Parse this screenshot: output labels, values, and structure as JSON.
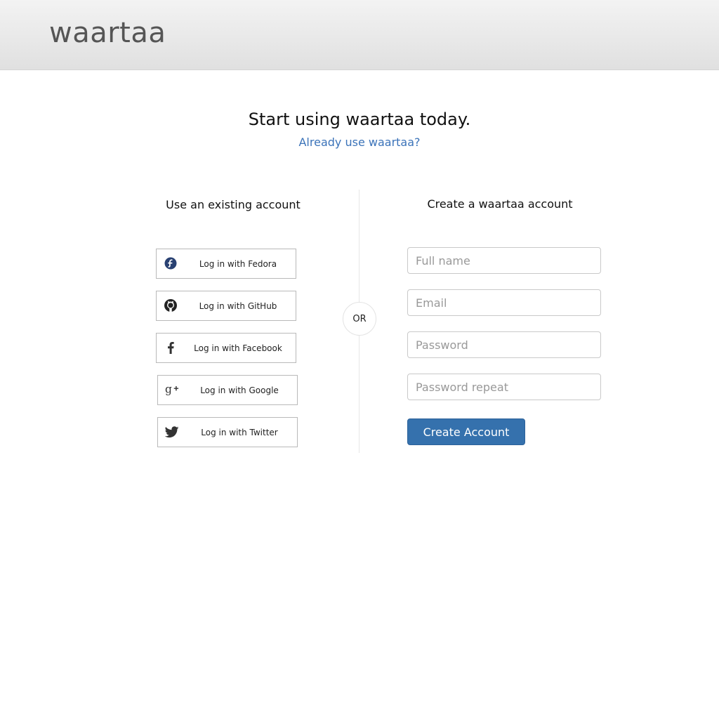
{
  "header": {
    "logo": "waartaa"
  },
  "hero": {
    "headline": "Start using waartaa today.",
    "signin_link": "Already use waartaa?"
  },
  "existing": {
    "title": "Use an existing account",
    "buttons": [
      {
        "label": "Log in with Fedora",
        "icon": "fedora-icon"
      },
      {
        "label": "Log in with GitHub",
        "icon": "github-icon"
      },
      {
        "label": "Log in with Facebook",
        "icon": "facebook-icon"
      },
      {
        "label": "Log in with Google",
        "icon": "google-plus-icon"
      },
      {
        "label": "Log in with Twitter",
        "icon": "twitter-icon"
      }
    ]
  },
  "separator": {
    "label": "OR"
  },
  "create": {
    "title": "Create a waartaa account",
    "fields": {
      "fullname_placeholder": "Full name",
      "email_placeholder": "Email",
      "password_placeholder": "Password",
      "password_repeat_placeholder": "Password repeat"
    },
    "submit_label": "Create Account"
  },
  "colors": {
    "link": "#3b73b9",
    "primary_button": "#3571ad",
    "fedora": "#294172"
  }
}
